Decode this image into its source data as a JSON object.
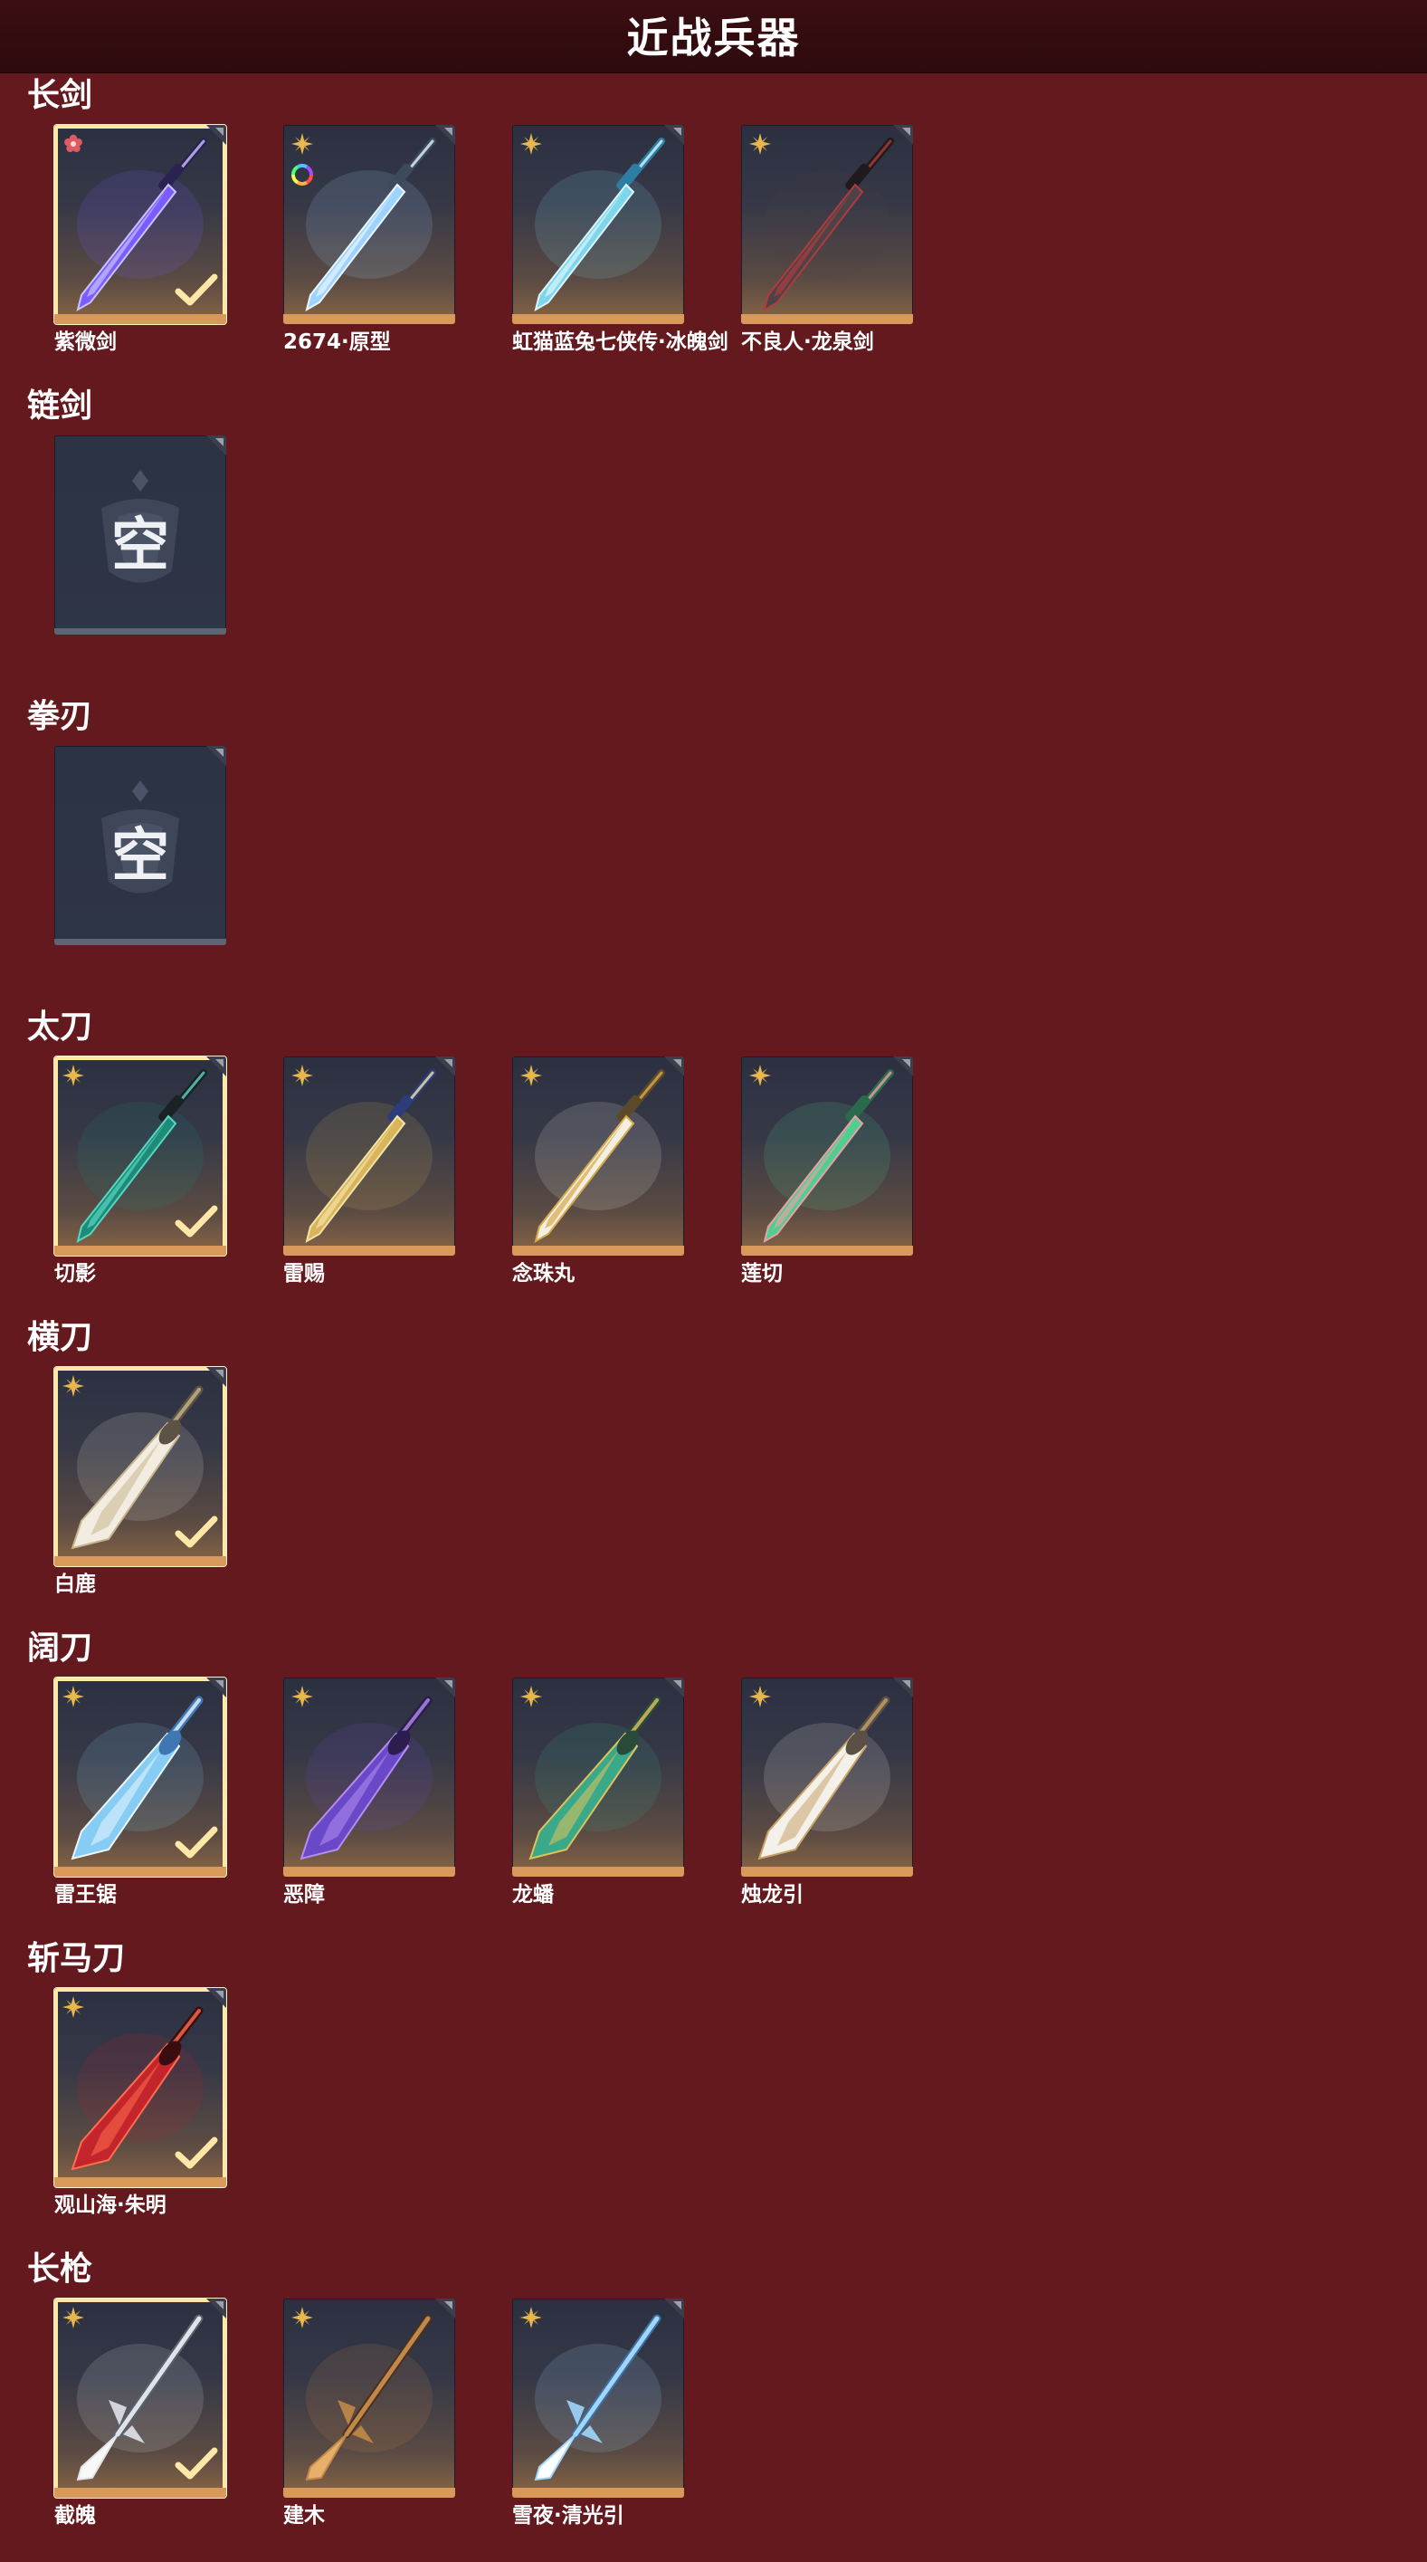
{
  "header": {
    "title": "近战兵器"
  },
  "sections": [
    {
      "title": "长剑",
      "items": [
        {
          "name": "紫微剑",
          "selected": true,
          "rarity": "red-flower-icon",
          "art": "purple-sword"
        },
        {
          "name": "2674·原型",
          "selected": false,
          "rarity": "gold-star-icon",
          "extra": "rainbow-ring-icon",
          "art": "light-sword"
        },
        {
          "name": "虹猫蓝兔七侠传·冰魄剑",
          "selected": false,
          "rarity": "gold-star-icon",
          "art": "ice-sword"
        },
        {
          "name": "不良人·龙泉剑",
          "selected": false,
          "rarity": "gold-star-icon",
          "art": "dark-sword"
        }
      ]
    },
    {
      "title": "链剑",
      "items": [
        {
          "name": "",
          "empty": true,
          "empty_label": "空"
        }
      ]
    },
    {
      "title": "拳刃",
      "items": [
        {
          "name": "",
          "empty": true,
          "empty_label": "空"
        }
      ]
    },
    {
      "title": "太刀",
      "items": [
        {
          "name": "切影",
          "selected": true,
          "rarity": "gold-star-icon",
          "art": "teal-katana"
        },
        {
          "name": "雷赐",
          "selected": false,
          "rarity": "gold-star-icon",
          "art": "gold-blue-katana"
        },
        {
          "name": "念珠丸",
          "selected": false,
          "rarity": "gold-star-icon",
          "art": "white-gold-katana"
        },
        {
          "name": "莲切",
          "selected": false,
          "rarity": "gold-star-icon",
          "art": "green-katana"
        }
      ]
    },
    {
      "title": "横刀",
      "items": [
        {
          "name": "白鹿",
          "selected": true,
          "rarity": "gold-star-icon",
          "art": "white-blade"
        }
      ]
    },
    {
      "title": "阔刀",
      "items": [
        {
          "name": "雷王锯",
          "selected": true,
          "rarity": "gold-star-icon",
          "art": "lightning-blade"
        },
        {
          "name": "恶障",
          "selected": false,
          "rarity": "gold-star-icon",
          "art": "purple-blade"
        },
        {
          "name": "龙蟠",
          "selected": false,
          "rarity": "gold-star-icon",
          "art": "jade-blade"
        },
        {
          "name": "烛龙引",
          "selected": false,
          "rarity": "gold-star-icon",
          "art": "white-dragon-blade"
        }
      ]
    },
    {
      "title": "斩马刀",
      "items": [
        {
          "name": "观山海·朱明",
          "selected": true,
          "rarity": "gold-star-icon",
          "art": "red-blade"
        }
      ]
    },
    {
      "title": "长枪",
      "items": [
        {
          "name": "截魄",
          "selected": true,
          "rarity": "gold-star-icon",
          "art": "silver-spear"
        },
        {
          "name": "建木",
          "selected": false,
          "rarity": "gold-star-icon",
          "art": "wood-spear"
        },
        {
          "name": "雪夜·清光引",
          "selected": false,
          "rarity": "gold-star-icon",
          "art": "ice-spear"
        }
      ]
    }
  ],
  "colors": {
    "background": "#63191e",
    "header": "#2e0a0d",
    "selected_border": "#ffe7a8",
    "tile_strip": "#d9995a",
    "rarity_gold": "#e8b84e",
    "rarity_red": "#e05a63"
  }
}
